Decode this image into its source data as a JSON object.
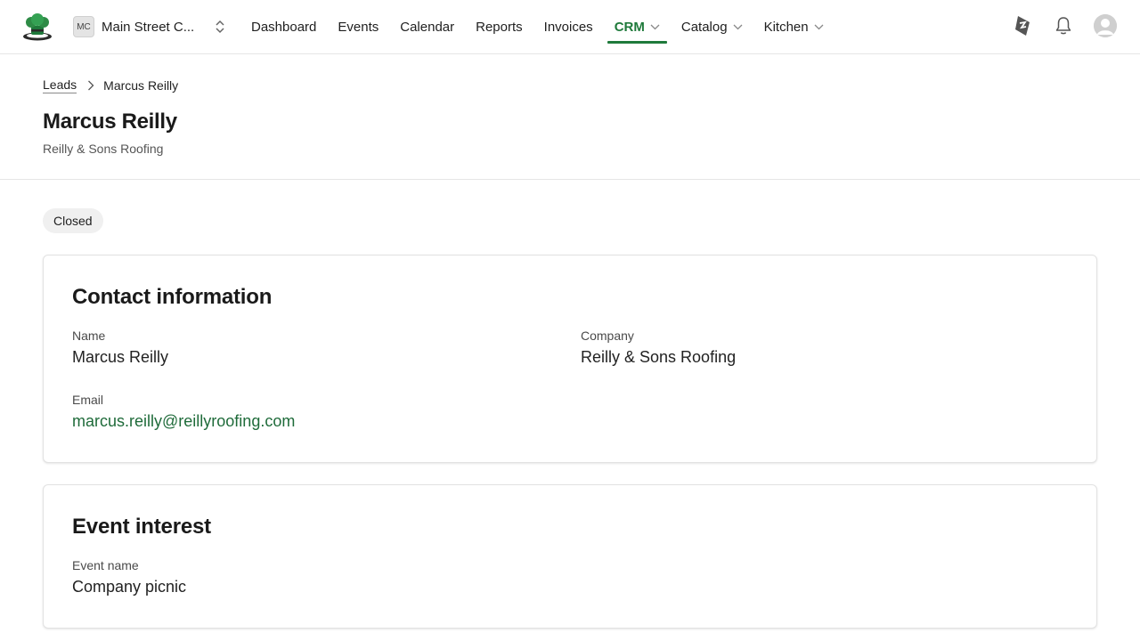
{
  "colors": {
    "accent": "#1f7a3b",
    "link": "#1f6b3a",
    "border": "#e6e6e6",
    "badge_bg": "#f0f0f0"
  },
  "header": {
    "logo_icon": "chef-hat-icon",
    "workspace": {
      "initials": "MC",
      "name": "Main Street C...",
      "switch_icon": "chevron-up-down-icon"
    },
    "nav": [
      {
        "label": "Dashboard"
      },
      {
        "label": "Events"
      },
      {
        "label": "Calendar"
      },
      {
        "label": "Reports"
      },
      {
        "label": "Invoices"
      },
      {
        "label": "CRM",
        "active": true,
        "dropdown": true
      },
      {
        "label": "Catalog",
        "dropdown": true
      },
      {
        "label": "Kitchen",
        "dropdown": true
      }
    ],
    "icons": [
      "announcement-icon",
      "bell-icon",
      "avatar-icon"
    ]
  },
  "breadcrumb": {
    "parent": "Leads",
    "current": "Marcus Reilly"
  },
  "page": {
    "title": "Marcus Reilly",
    "subtitle": "Reilly & Sons Roofing",
    "status": "Closed"
  },
  "contact": {
    "heading": "Contact information",
    "name_label": "Name",
    "name_value": "Marcus Reilly",
    "company_label": "Company",
    "company_value": "Reilly & Sons Roofing",
    "email_label": "Email",
    "email_value": "marcus.reilly@reillyroofing.com"
  },
  "event": {
    "heading": "Event interest",
    "event_name_label": "Event name",
    "event_name_value": "Company picnic"
  }
}
